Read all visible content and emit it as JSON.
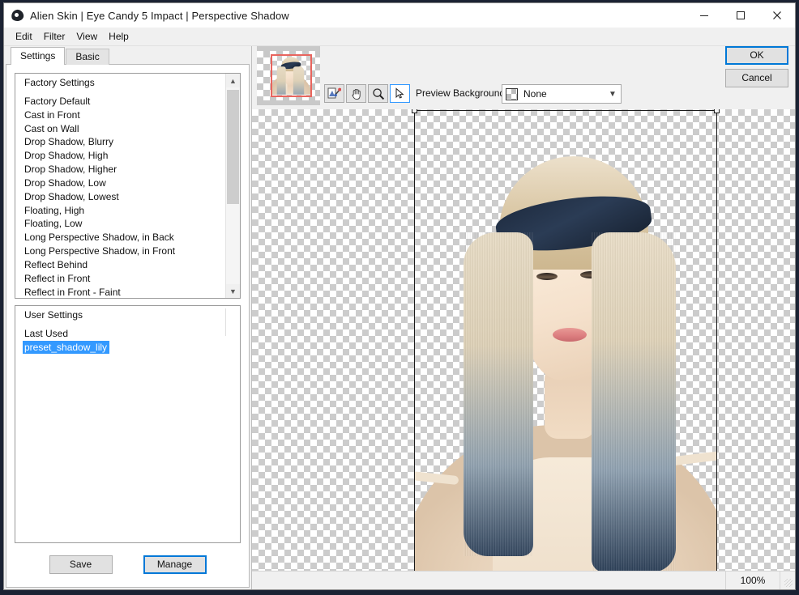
{
  "window": {
    "title": "Alien Skin | Eye Candy 5 Impact | Perspective Shadow",
    "app_icon": "alien-head-icon",
    "controls": {
      "minimize": "minimize-icon",
      "maximize": "maximize-icon",
      "close": "close-icon"
    }
  },
  "menubar": {
    "items": [
      "Edit",
      "Filter",
      "View",
      "Help"
    ]
  },
  "tabs": [
    {
      "label": "Settings",
      "active": true
    },
    {
      "label": "Basic",
      "active": false
    }
  ],
  "factory_settings": {
    "header": "Factory Settings",
    "items": [
      "Factory Default",
      "Cast in Front",
      "Cast on Wall",
      "Drop Shadow, Blurry",
      "Drop Shadow, High",
      "Drop Shadow, Higher",
      "Drop Shadow, Low",
      "Drop Shadow, Lowest",
      "Floating, High",
      "Floating, Low",
      "Long Perspective Shadow, in Back",
      "Long Perspective Shadow, in Front",
      "Reflect Behind",
      "Reflect in Front",
      "Reflect in Front - Faint"
    ]
  },
  "user_settings": {
    "header": "User Settings",
    "items": [
      {
        "label": "Last Used",
        "selected": false
      },
      {
        "label": "preset_shadow_lily",
        "selected": true
      }
    ]
  },
  "buttons": {
    "save": "Save",
    "manage": "Manage",
    "ok": "OK",
    "cancel": "Cancel"
  },
  "toolbar": {
    "tools": [
      {
        "name": "color-picker-tool",
        "active": false
      },
      {
        "name": "hand-pan-tool",
        "active": false
      },
      {
        "name": "zoom-magnifier-tool",
        "active": false
      },
      {
        "name": "arrow-select-tool",
        "active": true
      }
    ],
    "preview_background_label": "Preview Background:",
    "preview_background_value": "None"
  },
  "statusbar": {
    "zoom": "100%"
  },
  "colors": {
    "accent": "#0078d7",
    "selection": "#3399ff",
    "window_bg": "#f0f0f0",
    "navigator_viewport": "#e8655e",
    "desktop": "#1b2233"
  }
}
